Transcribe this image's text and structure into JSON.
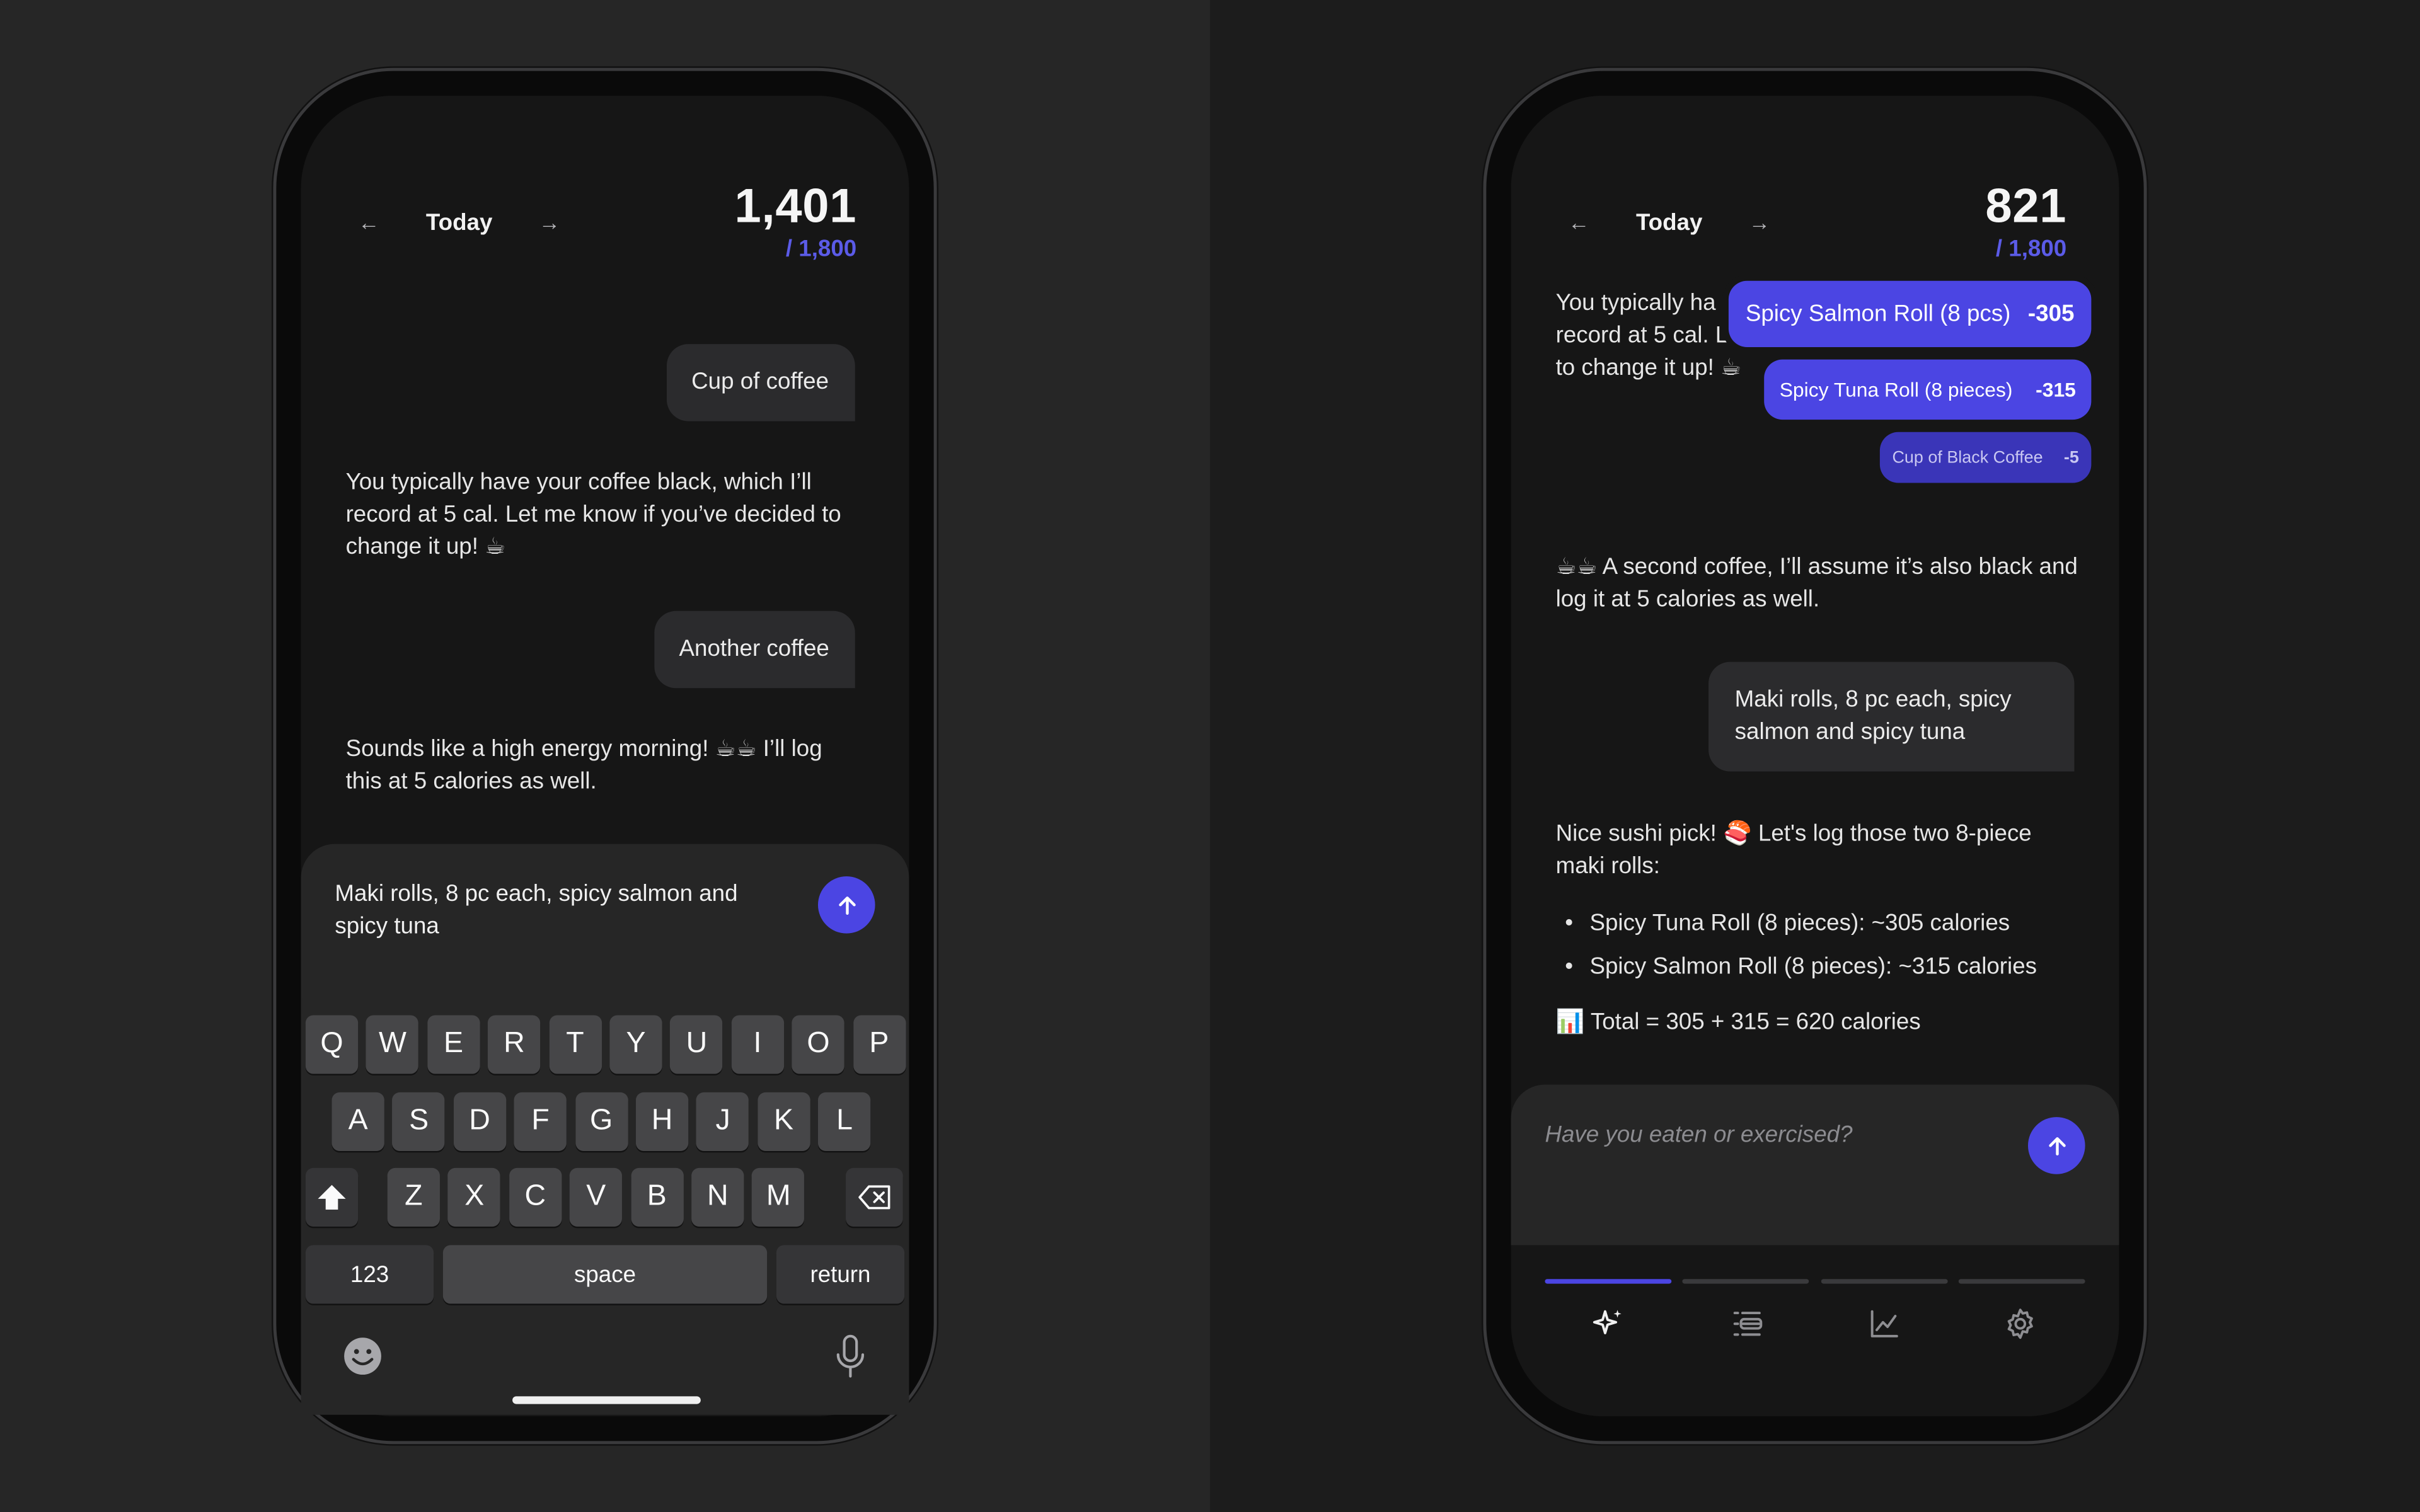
{
  "colors": {
    "accent": "#4b45e3",
    "goal_text": "#5b5be8",
    "background": "#161616"
  },
  "left_phone": {
    "header": {
      "prev_icon": "arrow-left-icon",
      "title": "Today",
      "next_icon": "arrow-right-icon",
      "calories_total": "1,401",
      "calories_goal": "/ 1,800"
    },
    "messages": [
      {
        "role": "user",
        "text": "Cup of coffee"
      },
      {
        "role": "assistant",
        "text": "You typically have your coffee black, which I’ll record at 5 cal. Let me know if you’ve decided to change it up! ☕"
      },
      {
        "role": "user",
        "text": "Another coffee"
      },
      {
        "role": "assistant",
        "text": "Sounds like a high energy morning! ☕☕ I’ll log this at 5 calories as well."
      }
    ],
    "input": {
      "value": "Maki rolls, 8 pc each, spicy salmon and spicy tuna",
      "send_icon": "arrow-up-icon"
    },
    "keyboard": {
      "row1": [
        "Q",
        "W",
        "E",
        "R",
        "T",
        "Y",
        "U",
        "I",
        "O",
        "P"
      ],
      "row2": [
        "A",
        "S",
        "D",
        "F",
        "G",
        "H",
        "J",
        "K",
        "L"
      ],
      "row3": [
        "Z",
        "X",
        "C",
        "V",
        "B",
        "N",
        "M"
      ],
      "shift_icon": "shift-icon",
      "delete_icon": "backspace-icon",
      "numbers_label": "123",
      "space_label": "space",
      "return_label": "return",
      "emoji_icon": "emoji-icon",
      "mic_icon": "microphone-icon"
    }
  },
  "right_phone": {
    "header": {
      "prev_icon": "arrow-left-icon",
      "title": "Today",
      "next_icon": "arrow-right-icon",
      "calories_total": "821",
      "calories_goal": "/ 1,800"
    },
    "partial_message": "You typically ha\nrecord at 5 cal. L\nto change it up! ☕",
    "logged_items": [
      {
        "name": "Spicy Salmon Roll (8 pcs)",
        "calories": "-305"
      },
      {
        "name": "Spicy Tuna Roll (8 pieces)",
        "calories": "-315"
      },
      {
        "name": "Cup of Black Coffee",
        "calories": "-5"
      }
    ],
    "messages": [
      {
        "role": "assistant",
        "text": "☕☕ A second coffee, I’ll assume it’s also black and log it at 5 calories as well."
      },
      {
        "role": "user",
        "text": "Maki rolls, 8 pc each, spicy salmon and spicy tuna"
      },
      {
        "role": "assistant",
        "intro": "Nice sushi pick! 🍣 Let's log those two 8-piece maki rolls:",
        "bullets": [
          "Spicy Tuna Roll (8 pieces): ~305 calories",
          "Spicy Salmon Roll (8 pieces): ~315 calories"
        ],
        "total": "📊 Total = 305 + 315 = 620 calories"
      }
    ],
    "input": {
      "placeholder": "Have you eaten or exercised?",
      "send_icon": "arrow-up-icon"
    },
    "tabs": [
      {
        "icon": "sparkles-icon",
        "active": true
      },
      {
        "icon": "list-icon",
        "active": false
      },
      {
        "icon": "chart-icon",
        "active": false
      },
      {
        "icon": "gear-icon",
        "active": false
      }
    ]
  }
}
